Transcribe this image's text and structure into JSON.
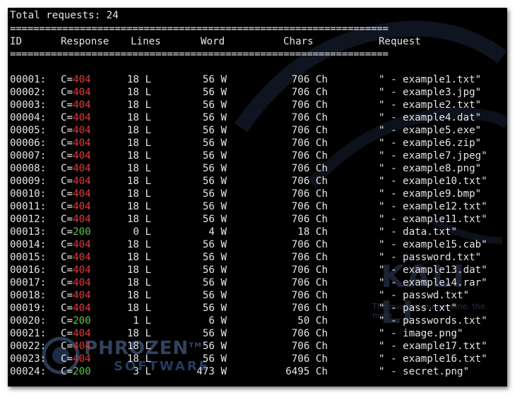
{
  "terminal": {
    "total_line": "Total requests: 24",
    "separator": "=================================================================",
    "headers": {
      "id": "ID",
      "response": "Response",
      "lines": "Lines",
      "word": "Word",
      "chars": "Chars",
      "request": "Request"
    },
    "rows": [
      {
        "id": "00001:",
        "prefix": "C=",
        "code": "404",
        "lines": "18 L",
        "word": "56 W",
        "chars": "706 Ch",
        "request": "\" - example1.txt\""
      },
      {
        "id": "00002:",
        "prefix": "C=",
        "code": "404",
        "lines": "18 L",
        "word": "56 W",
        "chars": "706 Ch",
        "request": "\" - example3.jpg\""
      },
      {
        "id": "00003:",
        "prefix": "C=",
        "code": "404",
        "lines": "18 L",
        "word": "56 W",
        "chars": "706 Ch",
        "request": "\" - example2.txt\""
      },
      {
        "id": "00004:",
        "prefix": "C=",
        "code": "404",
        "lines": "18 L",
        "word": "56 W",
        "chars": "706 Ch",
        "request": "\" - example4.dat\""
      },
      {
        "id": "00005:",
        "prefix": "C=",
        "code": "404",
        "lines": "18 L",
        "word": "56 W",
        "chars": "706 Ch",
        "request": "\" - example5.exe\""
      },
      {
        "id": "00006:",
        "prefix": "C=",
        "code": "404",
        "lines": "18 L",
        "word": "56 W",
        "chars": "706 Ch",
        "request": "\" - example6.zip\""
      },
      {
        "id": "00007:",
        "prefix": "C=",
        "code": "404",
        "lines": "18 L",
        "word": "56 W",
        "chars": "706 Ch",
        "request": "\" - example7.jpeg\""
      },
      {
        "id": "00008:",
        "prefix": "C=",
        "code": "404",
        "lines": "18 L",
        "word": "56 W",
        "chars": "706 Ch",
        "request": "\" - example8.png\""
      },
      {
        "id": "00009:",
        "prefix": "C=",
        "code": "404",
        "lines": "18 L",
        "word": "56 W",
        "chars": "706 Ch",
        "request": "\" - example10.txt\""
      },
      {
        "id": "00010:",
        "prefix": "C=",
        "code": "404",
        "lines": "18 L",
        "word": "56 W",
        "chars": "706 Ch",
        "request": "\" - example9.bmp\""
      },
      {
        "id": "00011:",
        "prefix": "C=",
        "code": "404",
        "lines": "18 L",
        "word": "56 W",
        "chars": "706 Ch",
        "request": "\" - example12.txt\""
      },
      {
        "id": "00012:",
        "prefix": "C=",
        "code": "404",
        "lines": "18 L",
        "word": "56 W",
        "chars": "706 Ch",
        "request": "\" - example11.txt\""
      },
      {
        "id": "00013:",
        "prefix": "C=",
        "code": "200",
        "lines": "0 L",
        "word": "4 W",
        "chars": "18 Ch",
        "request": "\" - data.txt\""
      },
      {
        "id": "00014:",
        "prefix": "C=",
        "code": "404",
        "lines": "18 L",
        "word": "56 W",
        "chars": "706 Ch",
        "request": "\" - example15.cab\""
      },
      {
        "id": "00015:",
        "prefix": "C=",
        "code": "404",
        "lines": "18 L",
        "word": "56 W",
        "chars": "706 Ch",
        "request": "\" - password.txt\""
      },
      {
        "id": "00016:",
        "prefix": "C=",
        "code": "404",
        "lines": "18 L",
        "word": "56 W",
        "chars": "706 Ch",
        "request": "\" - example13.dat\""
      },
      {
        "id": "00017:",
        "prefix": "C=",
        "code": "404",
        "lines": "18 L",
        "word": "56 W",
        "chars": "706 Ch",
        "request": "\" - example14.rar\""
      },
      {
        "id": "00018:",
        "prefix": "C=",
        "code": "404",
        "lines": "18 L",
        "word": "56 W",
        "chars": "706 Ch",
        "request": "\" - passwd.txt\""
      },
      {
        "id": "00019:",
        "prefix": "C=",
        "code": "404",
        "lines": "18 L",
        "word": "56 W",
        "chars": "706 Ch",
        "request": "\" - pass.txt\""
      },
      {
        "id": "00020:",
        "prefix": "C=",
        "code": "200",
        "lines": "1 L",
        "word": "6 W",
        "chars": "50 Ch",
        "request": "\" - passwords.txt\""
      },
      {
        "id": "00021:",
        "prefix": "C=",
        "code": "404",
        "lines": "18 L",
        "word": "56 W",
        "chars": "706 Ch",
        "request": "\" - image.png\""
      },
      {
        "id": "00022:",
        "prefix": "C=",
        "code": "404",
        "lines": "18 L",
        "word": "56 W",
        "chars": "706 Ch",
        "request": "\" - example17.txt\""
      },
      {
        "id": "00023:",
        "prefix": "C=",
        "code": "404",
        "lines": "18 L",
        "word": "56 W",
        "chars": "706 Ch",
        "request": "\" - example16.txt\""
      },
      {
        "id": "00024:",
        "prefix": "C=",
        "code": "200",
        "lines": "3 L",
        "word": "473 W",
        "chars": "6495 Ch",
        "request": "\" - secret.png\""
      }
    ]
  },
  "watermarks": {
    "kali_text": "KALI LI",
    "kali_sub": "The quieter you become, the more",
    "phozen_name": "PHROZEN",
    "phozen_tm": "TM",
    "phozen_soft": "SOFTWARE"
  },
  "colors": {
    "error": "#e03b3b",
    "ok": "#5ec24a",
    "text": "#e6e6e6",
    "background": "#000000"
  }
}
